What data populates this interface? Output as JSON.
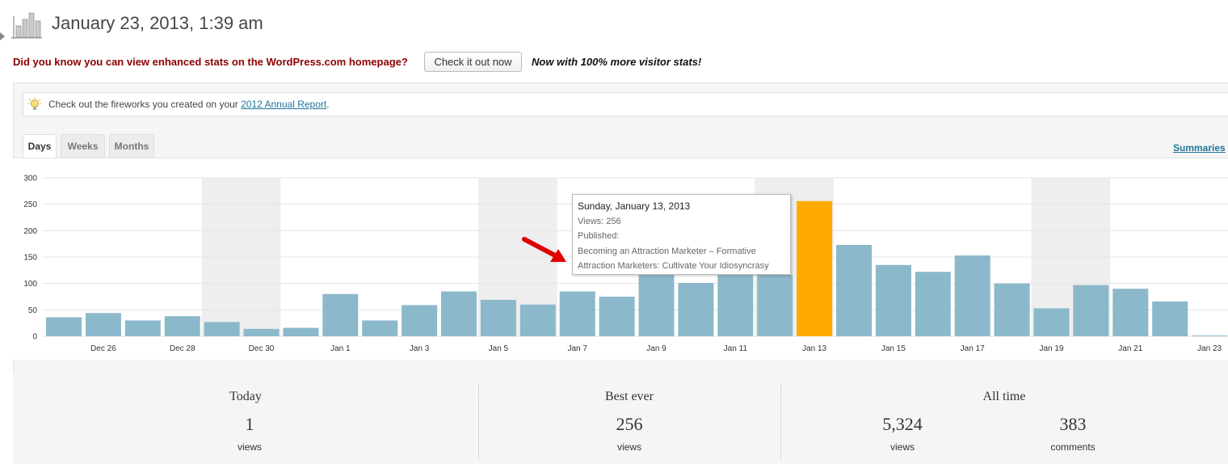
{
  "header": {
    "title": "January 23, 2013, 1:39 am",
    "icon": "bar-chart-icon"
  },
  "promo": {
    "text": "Did you know you can view enhanced stats on the WordPress.com homepage?",
    "button_label": "Check it out now",
    "note": "Now with 100% more visitor stats!"
  },
  "notice": {
    "icon": "lightbulb-icon",
    "text_before": "Check out the fireworks you created on your ",
    "link_text": "2012 Annual Report",
    "text_after": "."
  },
  "tabs": [
    {
      "label": "Days",
      "active": true
    },
    {
      "label": "Weeks",
      "active": false
    },
    {
      "label": "Months",
      "active": false
    }
  ],
  "summaries_link": "Summaries",
  "tooltip": {
    "date": "Sunday, January 13, 2013",
    "views": "Views: 256",
    "published_label": "Published:",
    "posts": [
      "Becoming an Attraction Marketer – Formative",
      "Attraction Marketers: Cultivate Your Idiosyncrasy"
    ]
  },
  "chart_data": {
    "type": "bar",
    "categories": [
      "Dec 25",
      "Dec 26",
      "Dec 27",
      "Dec 28",
      "Dec 29",
      "Dec 30",
      "Dec 31",
      "Jan 1",
      "Jan 2",
      "Jan 3",
      "Jan 4",
      "Jan 5",
      "Jan 6",
      "Jan 7",
      "Jan 8",
      "Jan 9",
      "Jan 10",
      "Jan 11",
      "Jan 12",
      "Jan 13",
      "Jan 14",
      "Jan 15",
      "Jan 16",
      "Jan 17",
      "Jan 18",
      "Jan 19",
      "Jan 20",
      "Jan 21",
      "Jan 22",
      "Jan 23"
    ],
    "values": [
      36,
      44,
      30,
      38,
      27,
      14,
      16,
      80,
      30,
      59,
      85,
      69,
      60,
      85,
      75,
      116,
      101,
      116,
      116,
      256,
      173,
      135,
      122,
      153,
      100,
      53,
      97,
      90,
      66,
      1
    ],
    "highlight_index": 19,
    "tick_labels": [
      "Dec 26",
      "Dec 28",
      "Dec 30",
      "Jan 1",
      "Jan 3",
      "Jan 5",
      "Jan 7",
      "Jan 9",
      "Jan 11",
      "Jan 13",
      "Jan 15",
      "Jan 17",
      "Jan 19",
      "Jan 21",
      "Jan 23"
    ],
    "y_ticks": [
      0,
      50,
      100,
      150,
      200,
      250,
      300
    ],
    "ylim": [
      0,
      300
    ],
    "weekend_shading": [
      [
        "Dec 29",
        "Dec 30"
      ],
      [
        "Jan 5",
        "Jan 6"
      ],
      [
        "Jan 12",
        "Jan 13"
      ],
      [
        "Jan 19",
        "Jan 20"
      ]
    ],
    "grid": true,
    "title": "",
    "xlabel": "",
    "ylabel": "",
    "colors": {
      "bar": "#8cb8cb",
      "highlight": "#ffaa00",
      "weekend": "#eeeeee",
      "grid": "#e5e5e5"
    }
  },
  "summary": {
    "today": {
      "title": "Today",
      "value": "1",
      "label": "views"
    },
    "best_ever": {
      "title": "Best ever",
      "value": "256",
      "label": "views"
    },
    "all_time": {
      "title": "All time",
      "views_value": "5,324",
      "views_label": "views",
      "comments_value": "383",
      "comments_label": "comments"
    }
  }
}
